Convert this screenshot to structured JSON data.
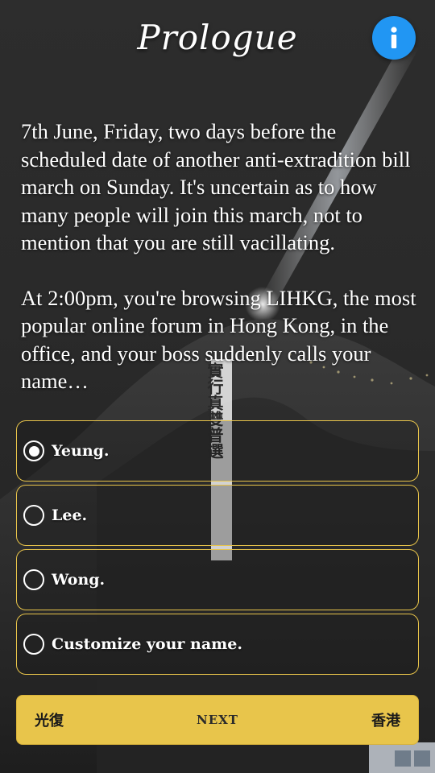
{
  "header": {
    "title": "Prologue",
    "info_icon": "info-icon",
    "info_color": "#2196f3"
  },
  "story": {
    "paragraph_1": "7th June, Friday, two days before the scheduled date of another anti-extradition bill march on Sunday. It's uncertain as to how many people will join this march, not to mention that you are still vacillating.",
    "paragraph_2": "At 2:00pm, you're browsing LIHKG, the most popular online forum in Hong Kong, in the office, and your boss suddenly calls your name…"
  },
  "banner_text": "實行真雙普選",
  "options": {
    "selected_index": 0,
    "accent_color": "#e8c44a",
    "items": [
      {
        "label": "Yeung."
      },
      {
        "label": "Lee."
      },
      {
        "label": "Wong."
      },
      {
        "label": "Customize your name."
      }
    ]
  },
  "next": {
    "left_text": "光復",
    "label": "NEXT",
    "right_text": "香港",
    "color": "#e8c54b"
  }
}
